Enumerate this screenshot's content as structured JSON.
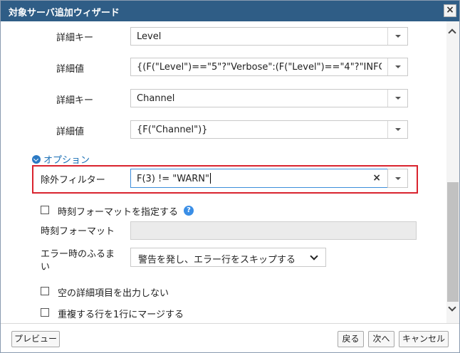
{
  "window": {
    "title": "対象サーバ追加ウィザード",
    "close_symbol": "×"
  },
  "details": [
    {
      "label": "詳細キー",
      "value": "Level"
    },
    {
      "label": "詳細値",
      "value": "{(F(\"Level\")==\"5\"?\"Verbose\":(F(\"Level\")==\"4\"?\"INFO\":(F("
    },
    {
      "label": "詳細キー",
      "value": "Channel"
    },
    {
      "label": "詳細値",
      "value": "{F(\"Channel\")}"
    }
  ],
  "options": {
    "section_label": "オプション",
    "exclude_filter": {
      "label": "除外フィルター",
      "value": "F(3) != \"WARN\"",
      "clear_symbol": "×"
    },
    "time_format_checkbox": {
      "label": "時刻フォーマットを指定する",
      "checked": false,
      "help_symbol": "?"
    },
    "time_format_field": {
      "label": "時刻フォーマット",
      "value": ""
    },
    "error_behavior": {
      "label_line1": "エラー時のふるま",
      "label_line2": "い",
      "selected": "警告を発し、エラー行をスキップする"
    },
    "no_empty_details": {
      "label": "空の詳細項目を出力しない",
      "checked": false
    },
    "merge_duplicates": {
      "label": "重複する行を1行にマージする",
      "checked": false
    }
  },
  "footer": {
    "preview": "プレビュー",
    "back": "戻る",
    "next": "次へ",
    "cancel": "キャンセル"
  }
}
